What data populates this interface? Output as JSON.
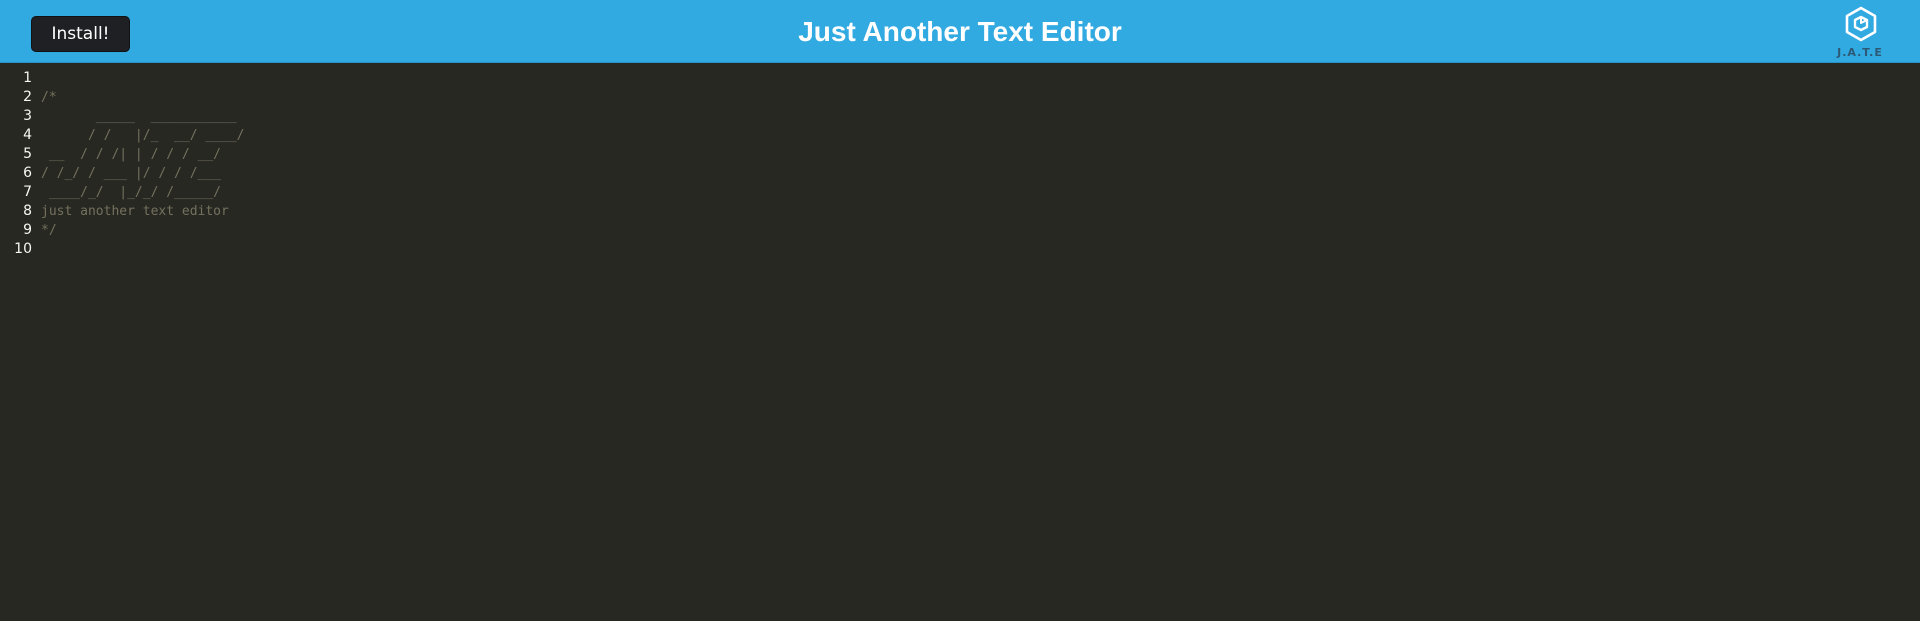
{
  "header": {
    "install_label": "Install!",
    "title": "Just Another Text Editor",
    "logo_text": "J.A.T.E",
    "logo_icon": "cube-logo-icon",
    "background_color": "#31a9e1"
  },
  "editor": {
    "background_color": "#272822",
    "comment_color": "#75715e",
    "line_numbers": [
      "1",
      "2",
      "3",
      "4",
      "5",
      "6",
      "7",
      "8",
      "9",
      "10"
    ],
    "lines": [
      "",
      "/*",
      "       _____  ___________",
      "      / /   |/_  __/ ____/",
      " __  / / /| | / / / __/",
      "/ /_/ / ___ |/ / / /___",
      " ____/_/  |_/_/ /_____/",
      "just another text editor",
      "*/",
      ""
    ]
  }
}
